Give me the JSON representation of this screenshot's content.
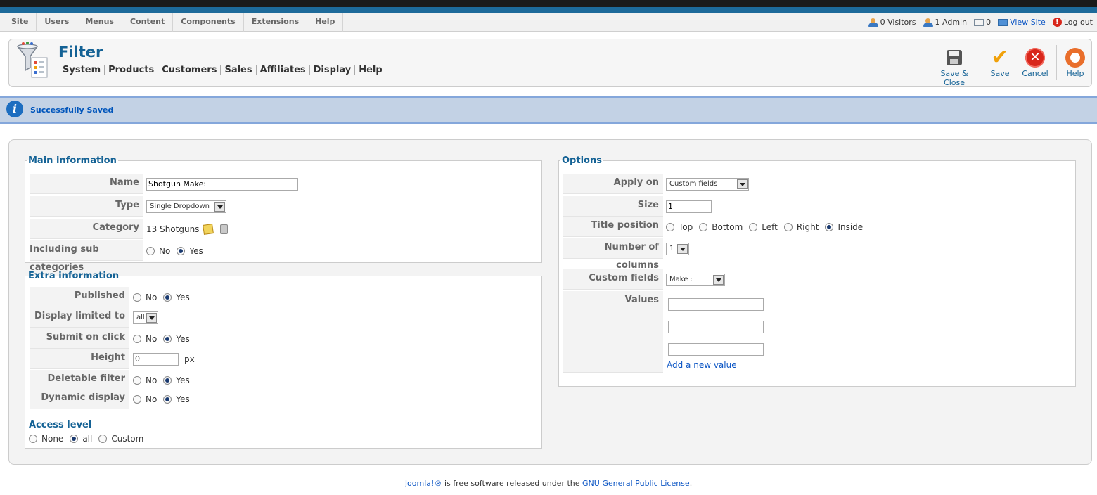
{
  "top_menu": [
    "Site",
    "Users",
    "Menus",
    "Content",
    "Components",
    "Extensions",
    "Help"
  ],
  "status": {
    "visitors": "0 Visitors",
    "admins": "1 Admin",
    "messages": "0",
    "view_site": "View Site",
    "logout": "Log out"
  },
  "header": {
    "title": "Filter",
    "submenu": [
      "System",
      "Products",
      "Customers",
      "Sales",
      "Affiliates",
      "Display",
      "Help"
    ]
  },
  "toolbar": {
    "save_close": "Save & Close",
    "save": "Save",
    "cancel": "Cancel",
    "help": "Help"
  },
  "message": "Successfully Saved",
  "main_info": {
    "legend": "Main information",
    "name_label": "Name",
    "name_value": "Shotgun Make:",
    "type_label": "Type",
    "type_value": "Single Dropdown",
    "category_label": "Category",
    "category_value": "13 Shotguns",
    "sub_label": "Including sub categories",
    "no": "No",
    "yes": "Yes"
  },
  "extra_info": {
    "legend": "Extra information",
    "published_label": "Published",
    "display_limited_label": "Display limited to",
    "display_limited_value": "all",
    "submit_label": "Submit on click",
    "height_label": "Height",
    "height_value": "0",
    "height_unit": "px",
    "deletable_label": "Deletable filter",
    "dynamic_label": "Dynamic display",
    "no": "No",
    "yes": "Yes"
  },
  "access": {
    "title": "Access level",
    "none": "None",
    "all": "all",
    "custom": "Custom"
  },
  "options": {
    "legend": "Options",
    "apply_on_label": "Apply on",
    "apply_on_value": "Custom fields",
    "size_label": "Size",
    "size_value": "1",
    "title_position_label": "Title position",
    "positions": [
      "Top",
      "Bottom",
      "Left",
      "Right",
      "Inside"
    ],
    "columns_label": "Number of columns",
    "columns_value": "1",
    "custom_fields_label": "Custom fields",
    "custom_fields_value": "Make :",
    "values_label": "Values",
    "add_value": "Add a new value"
  },
  "footer": {
    "joomla": "Joomla!®",
    "text": " is free software released under the ",
    "license": "GNU General Public License",
    "dot": "."
  }
}
